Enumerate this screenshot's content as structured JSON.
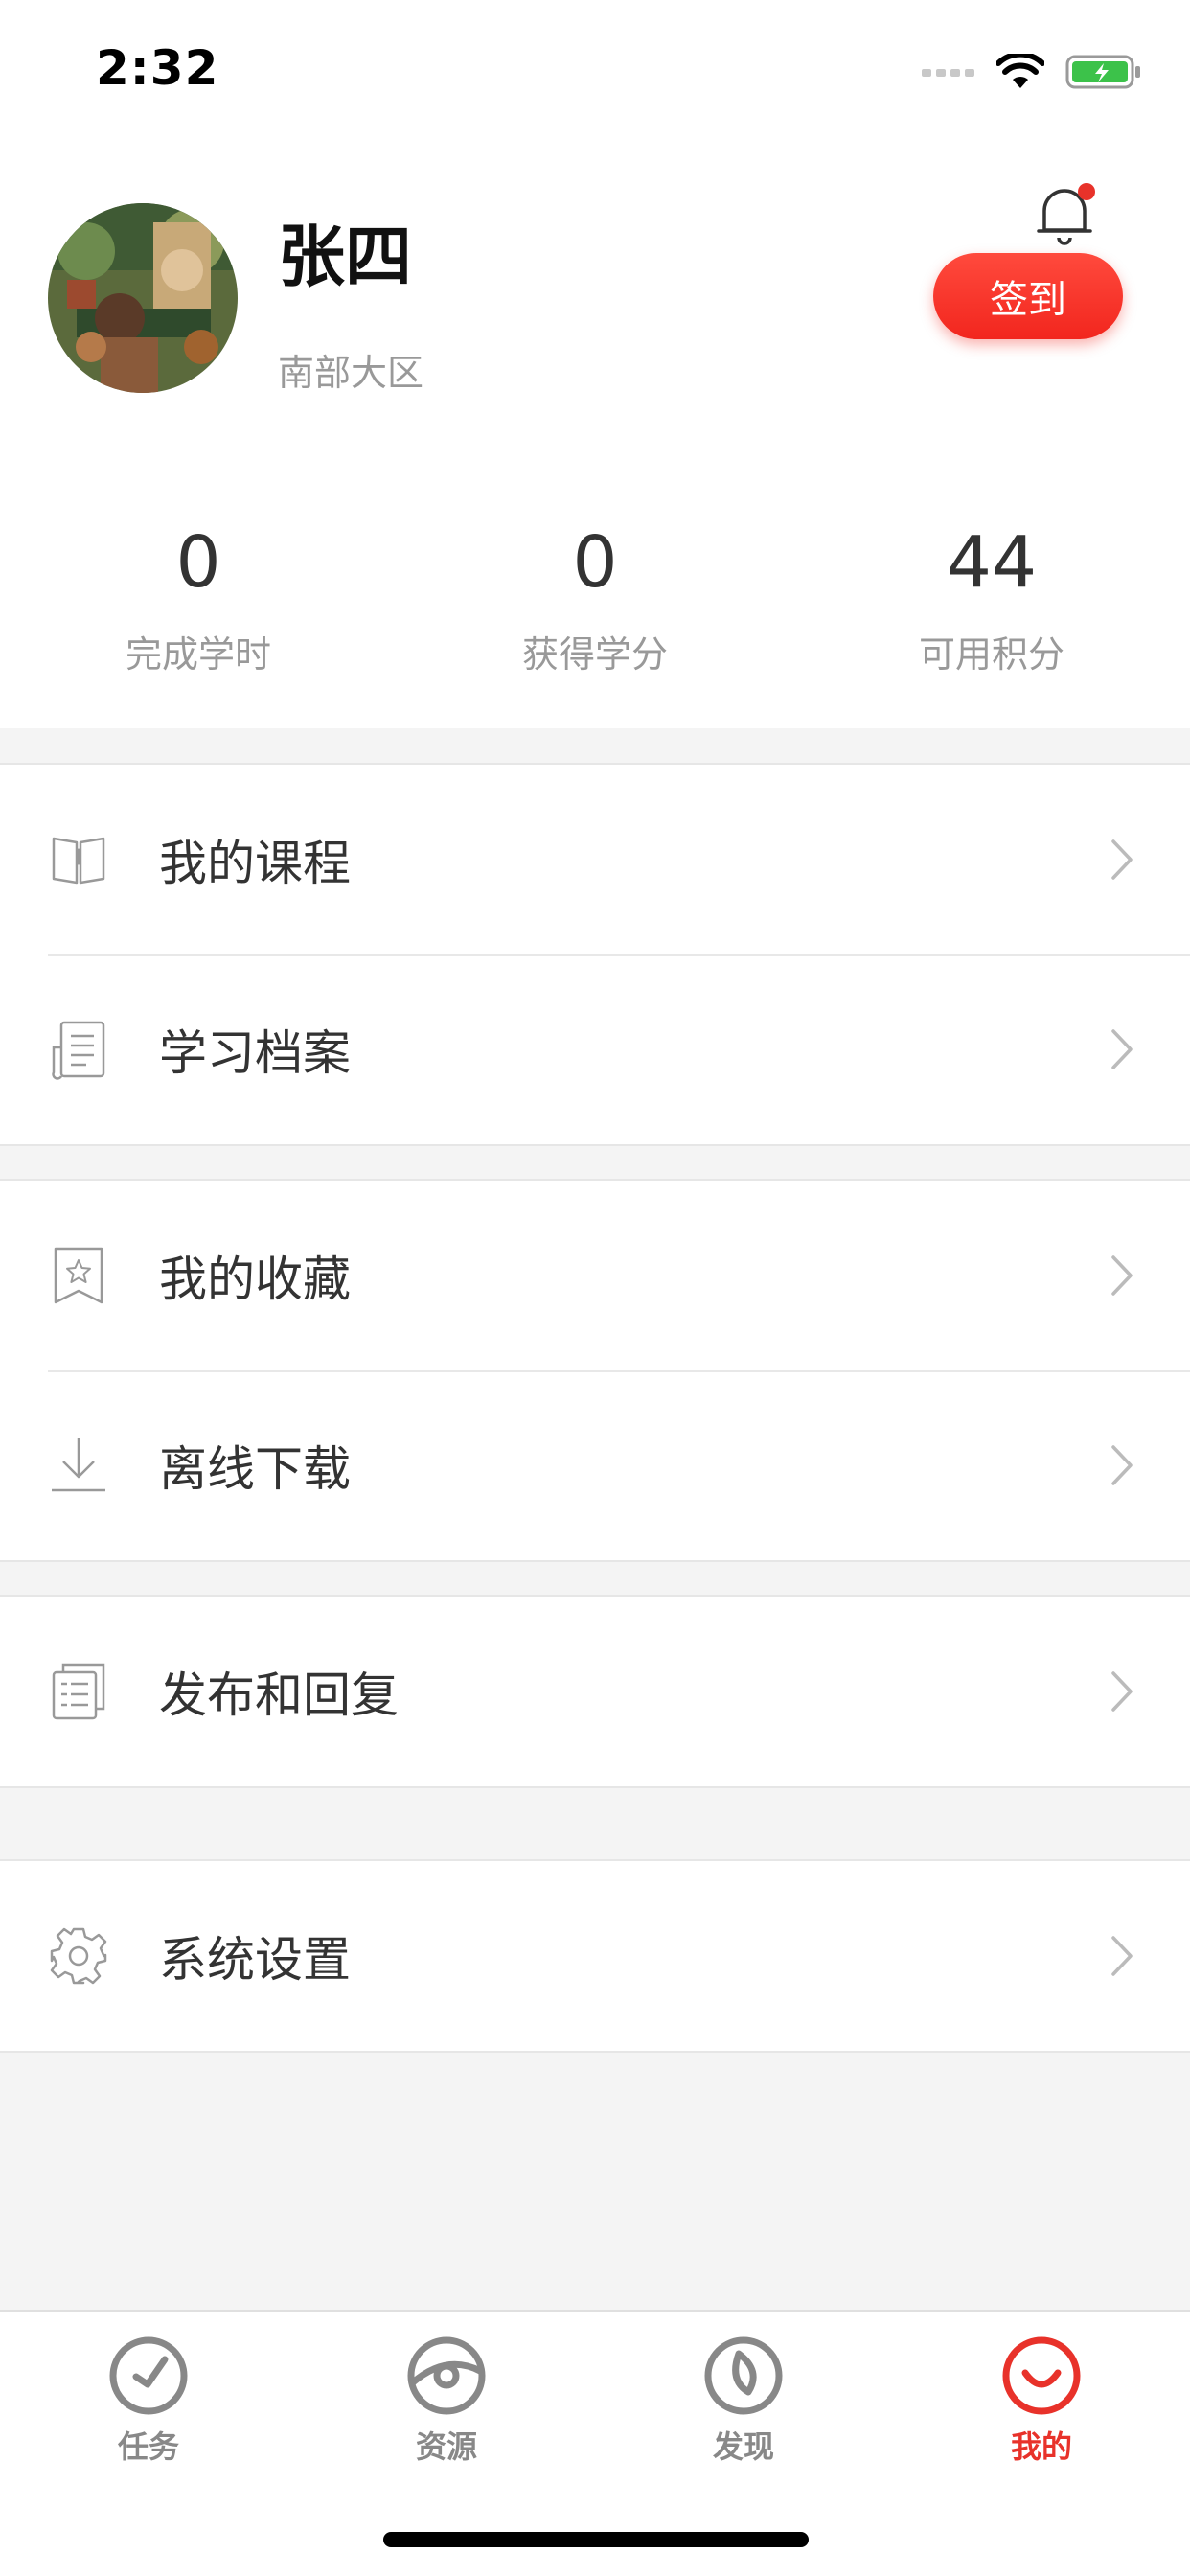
{
  "status_bar": {
    "time": "2:32"
  },
  "profile": {
    "name": "张四",
    "region": "南部大区",
    "checkin_label": "签到"
  },
  "stats": [
    {
      "value": "0",
      "label": "完成学时"
    },
    {
      "value": "0",
      "label": "获得学分"
    },
    {
      "value": "44",
      "label": "可用积分"
    }
  ],
  "menu": {
    "courses": "我的课程",
    "archive": "学习档案",
    "favorites": "我的收藏",
    "offline": "离线下载",
    "posts": "发布和回复",
    "settings": "系统设置"
  },
  "tabbar": [
    {
      "label": "任务",
      "icon": "task-icon",
      "active": false
    },
    {
      "label": "资源",
      "icon": "resource-icon",
      "active": false
    },
    {
      "label": "发现",
      "icon": "discover-icon",
      "active": false
    },
    {
      "label": "我的",
      "icon": "me-icon",
      "active": true
    }
  ],
  "colors": {
    "accent": "#e8322a",
    "background": "#f4f4f4",
    "icon_gray": "#999999"
  }
}
